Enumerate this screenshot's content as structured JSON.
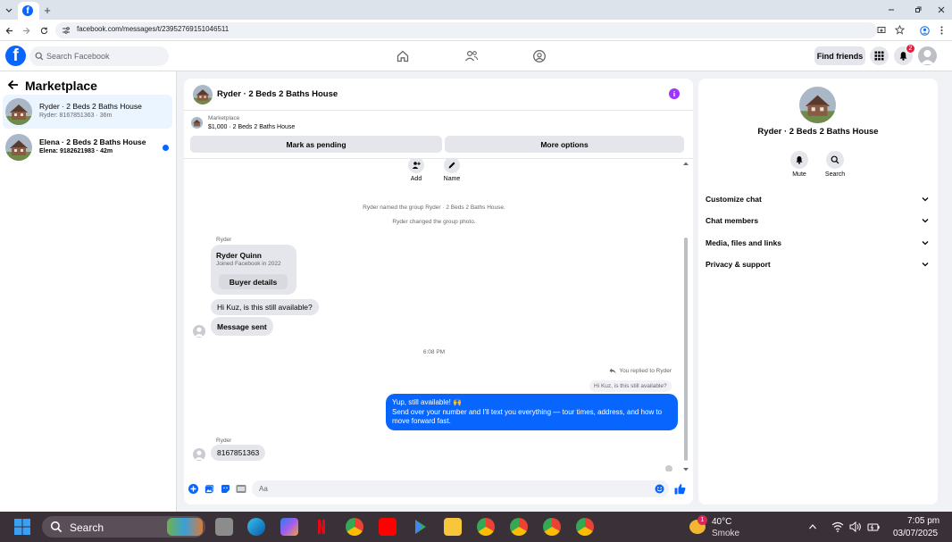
{
  "browser": {
    "url": "facebook.com/messages/t/23952769151046511",
    "new_tab_symbol": "+"
  },
  "header": {
    "logo_letter": "f",
    "search_placeholder": "Search Facebook",
    "find_friends": "Find friends",
    "notification_count": "2"
  },
  "sidebar": {
    "title": "Marketplace",
    "conversations": [
      {
        "title": "Ryder · 2 Beds 2 Baths House",
        "subtitle": "Ryder: 8167851363 · 36m",
        "selected": true
      },
      {
        "title": "Elena · 2 Beds 2 Baths House",
        "subtitle": "Elena: 9182621983 · 42m",
        "unread": true
      }
    ]
  },
  "chat": {
    "title": "Ryder · 2 Beds 2 Baths House",
    "listing_kicker": "Marketplace",
    "listing_price_line": "$1,000 · 2 Beds 2 Baths House",
    "mark_pending": "Mark as pending",
    "more_options": "More options",
    "top_actions": {
      "add": "Add",
      "name": "Name"
    },
    "system_messages": [
      "Ryder named the group Ryder · 2 Beds 2 Baths House.",
      "Ryder changed the group photo."
    ],
    "sender_name": "Ryder",
    "card": {
      "name": "Ryder Quinn",
      "subtitle": "Joined Facebook in 2022",
      "button": "Buyer details"
    },
    "incoming_1": "Hi Kuz, is this still available?",
    "incoming_2": "Message sent",
    "timestamp": "6:08 PM",
    "replied_to": "You replied to Ryder",
    "quoted": "Hi Kuz, is this still available?",
    "outgoing_line1": "Yup, still available! 🙌",
    "outgoing_line2": "Send over your number and I'll text you everything — tour times, address, and how to move forward fast.",
    "sender_name_2": "Ryder",
    "incoming_3": "8167851363",
    "composer_placeholder": "Aa"
  },
  "right_panel": {
    "name": "Ryder · 2 Beds 2 Baths House",
    "mute": "Mute",
    "search": "Search",
    "sections": [
      "Customize chat",
      "Chat members",
      "Media, files and links",
      "Privacy & support"
    ]
  },
  "taskbar": {
    "search_label": "Search",
    "weather_temp": "40°C",
    "weather_desc": "Smoke",
    "weather_badge": "1",
    "time": "7:05 pm",
    "date": "03/07/2025"
  },
  "colors": {
    "fb_blue": "#0866ff",
    "selected_conv": "#ebf5ff",
    "info_purple": "#a033ff"
  }
}
